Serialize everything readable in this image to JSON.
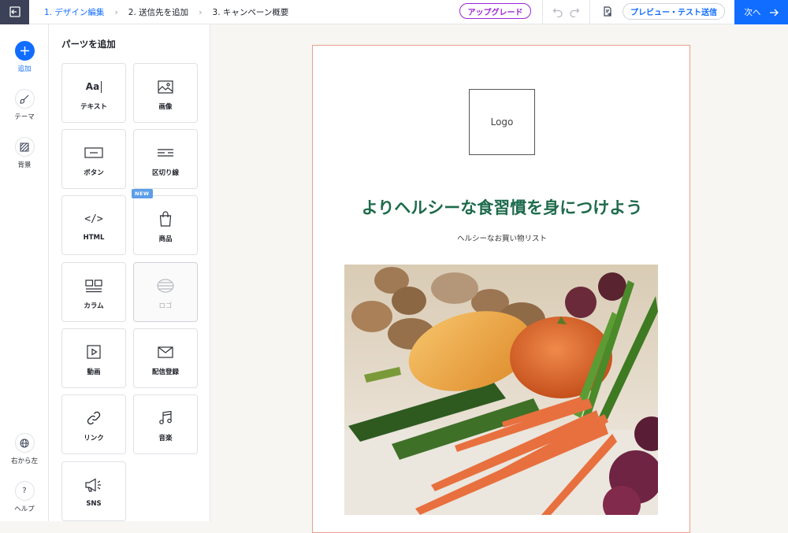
{
  "header": {
    "steps": [
      {
        "label": "1. デザイン編集",
        "active": true
      },
      {
        "label": "2. 送信先を追加",
        "active": false
      },
      {
        "label": "3. キャンペーン概要",
        "active": false
      }
    ],
    "upgrade_label": "アップグレード",
    "preview_label": "プレビュー・テスト送信",
    "next_label": "次へ"
  },
  "rail": {
    "add": "追加",
    "theme": "テーマ",
    "background": "背景",
    "rtl": "右から左",
    "help": "ヘルプ"
  },
  "panel": {
    "title": "パーツを追加",
    "tiles": [
      {
        "label": "テキスト",
        "icon": "text-icon"
      },
      {
        "label": "画像",
        "icon": "image-icon"
      },
      {
        "label": "ボタン",
        "icon": "button-icon"
      },
      {
        "label": "区切り線",
        "icon": "divider-icon"
      },
      {
        "label": "HTML",
        "icon": "code-icon"
      },
      {
        "label": "商品",
        "icon": "shopping-bag-icon",
        "badge": "NEW"
      },
      {
        "label": "カラム",
        "icon": "columns-icon"
      },
      {
        "label": "ロゴ",
        "icon": "logo-icon",
        "disabled": true
      },
      {
        "label": "動画",
        "icon": "video-icon"
      },
      {
        "label": "配信登録",
        "icon": "envelope-icon"
      },
      {
        "label": "リンク",
        "icon": "link-icon"
      },
      {
        "label": "音楽",
        "icon": "music-icon"
      },
      {
        "label": "SNS",
        "icon": "megaphone-icon"
      }
    ]
  },
  "email": {
    "logo_text": "Logo",
    "headline": "よりヘルシーな食習慣を身につけよう",
    "subline": "ヘルシーなお買い物リスト"
  },
  "colors": {
    "accent": "#116dff",
    "upgrade": "#9a27d5",
    "headline": "#1e6b4c",
    "email_border": "#e9a08e"
  }
}
